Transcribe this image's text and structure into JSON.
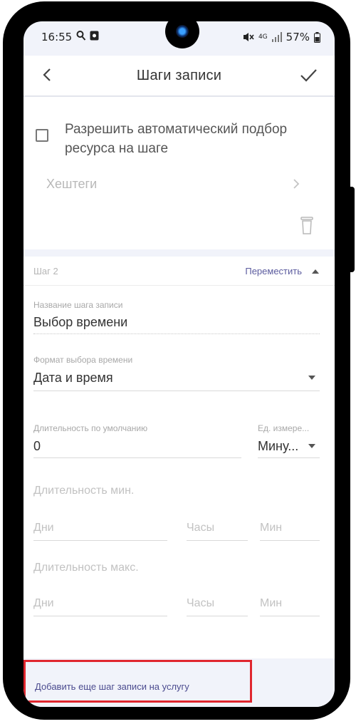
{
  "statusbar": {
    "time": "16:55",
    "network": "4G",
    "battery": "57%",
    "icons": [
      "search-icon",
      "notification-icon",
      "mute-icon",
      "signal-icon",
      "battery-icon"
    ]
  },
  "appbar": {
    "title": "Шаги записи",
    "back_icon": "arrow-left-icon",
    "confirm_icon": "check-icon"
  },
  "step1": {
    "auto_resource_label": "Разрешить автоматический подбор ресурса на шаге",
    "auto_resource_checked": false,
    "hashtags_label": "Хештеги"
  },
  "step2": {
    "step_label": "Шаг 2",
    "move_label": "Переместить",
    "name_field": {
      "label": "Название шага записи",
      "value": "Выбор времени"
    },
    "time_format_field": {
      "label": "Формат выбора времени",
      "value": "Дата и время"
    },
    "default_duration_field": {
      "label": "Длительность по умолчанию",
      "value": "0"
    },
    "unit_field": {
      "label": "Ед. измере...",
      "value": "Мину..."
    },
    "min_duration": {
      "title": "Длительность мин.",
      "days_placeholder": "Дни",
      "hours_placeholder": "Часы",
      "minutes_placeholder": "Мин"
    },
    "max_duration": {
      "title": "Длительность макс.",
      "days_placeholder": "Дни",
      "hours_placeholder": "Часы",
      "minutes_placeholder": "Мин"
    }
  },
  "footer": {
    "add_step_label": "Добавить еще шаг записи на услугу"
  },
  "colors": {
    "accent_link": "#5b5b9e",
    "highlight_border": "#e0262e",
    "background": "#f1f3fa"
  }
}
